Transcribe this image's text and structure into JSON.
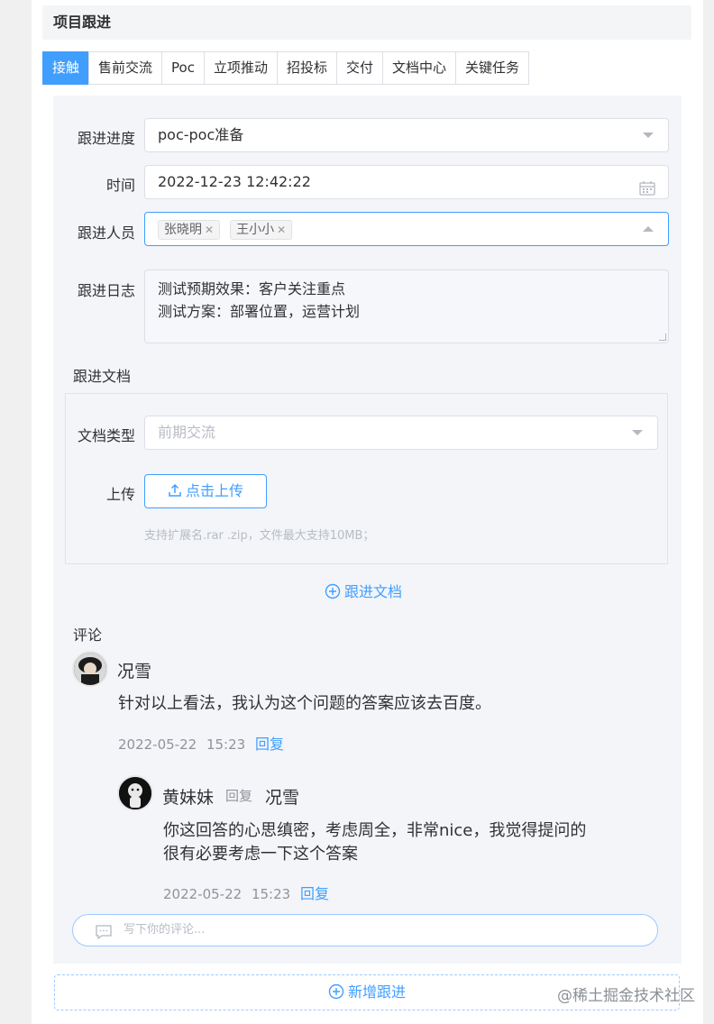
{
  "header": {
    "title": "项目跟进"
  },
  "tabs": [
    {
      "label": "接触",
      "active": true
    },
    {
      "label": "售前交流"
    },
    {
      "label": "Poc"
    },
    {
      "label": "立项推动"
    },
    {
      "label": "招投标"
    },
    {
      "label": "交付"
    },
    {
      "label": "文档中心"
    },
    {
      "label": "关键任务"
    }
  ],
  "form": {
    "progress_label": "跟进进度",
    "progress_value": "poc-poc准备",
    "time_label": "时间",
    "time_value": "2022-12-23 12:42:22",
    "people_label": "跟进人员",
    "people_tags": [
      "张晓明",
      "王小小"
    ],
    "log_label": "跟进日志",
    "log_lines": [
      "测试预期效果：客户关注重点",
      "测试方案：部署位置，运营计划"
    ],
    "docs_label": "跟进文档",
    "doc_type_label": "文档类型",
    "doc_type_placeholder": "前期交流",
    "upload_label": "上传",
    "upload_button": "点击上传",
    "upload_hint": "支持扩展名.rar .zip，文件最大支持10MB；",
    "add_doc_link": "跟进文档"
  },
  "comments": {
    "title": "评论",
    "items": [
      {
        "author": "况雪",
        "text": "针对以上看法，我认为这个问题的答案应该去百度。",
        "date": "2022-05-22",
        "time": "15:23",
        "reply_label": "回复"
      }
    ],
    "reply": {
      "author": "黄妹妹",
      "reply_word": "回复",
      "target": "况雪",
      "text_lines": [
        "你这回答的心思缜密，考虑周全，非常nice，我觉得提问的",
        "很有必要考虑一下这个答案"
      ],
      "date": "2022-05-22",
      "time": "15:23",
      "reply_label": "回复"
    },
    "input_placeholder": "写下你的评论..."
  },
  "footer": {
    "add_button": "新增跟进"
  },
  "watermark": "@稀土掘金技术社区",
  "colors": {
    "accent": "#409eff",
    "panel": "#f3f5f9"
  }
}
